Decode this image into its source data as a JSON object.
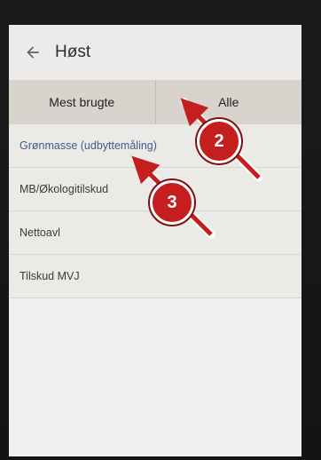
{
  "app_bar": {
    "title": "Høst"
  },
  "tabs": {
    "left": "Mest brugte",
    "right": "Alle"
  },
  "list_items": [
    "Grønmasse (udbyttemåling)",
    "MB/Økologitilskud",
    "Nettoavl",
    "Tilskud MVJ"
  ],
  "annotations": [
    {
      "label": "2"
    },
    {
      "label": "3"
    }
  ],
  "colors": {
    "annotation_red": "#c41e1e",
    "tab_bar_bg": "#d8d3cc",
    "link_blue": "#3b5e8a"
  },
  "icons": {
    "back": "arrow-left-icon"
  }
}
